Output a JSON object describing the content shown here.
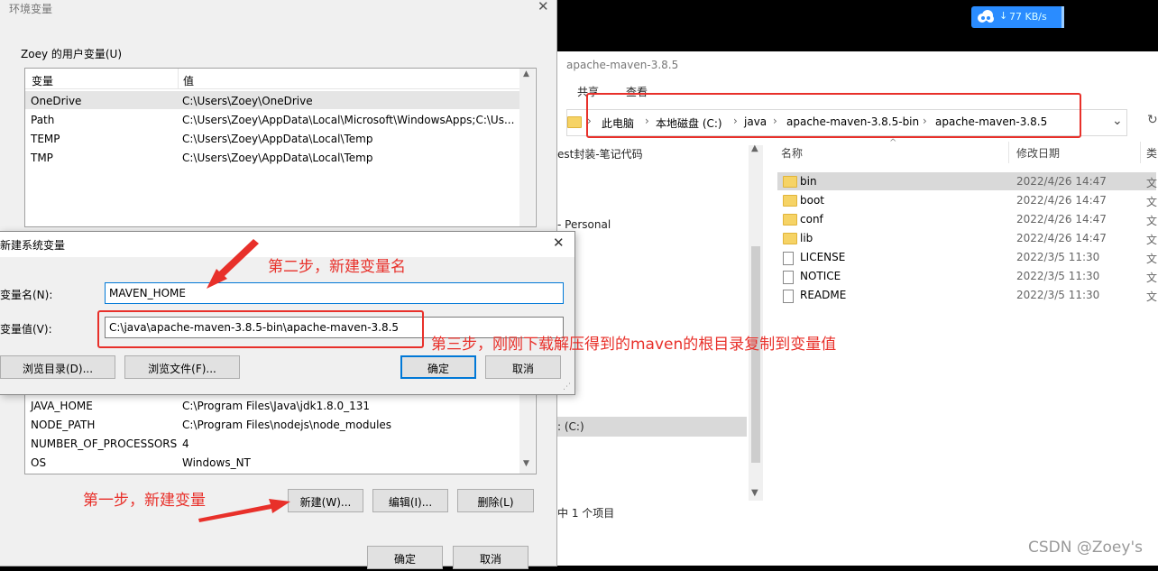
{
  "env_dialog": {
    "title": "环境变量",
    "user_group": "Zoey 的用户变量(U)",
    "headers": [
      "变量",
      "值"
    ],
    "user_vars": [
      {
        "name": "OneDrive",
        "value": "C:\\Users\\Zoey\\OneDrive"
      },
      {
        "name": "Path",
        "value": "C:\\Users\\Zoey\\AppData\\Local\\Microsoft\\WindowsApps;C:\\Us..."
      },
      {
        "name": "TEMP",
        "value": "C:\\Users\\Zoey\\AppData\\Local\\Temp"
      },
      {
        "name": "TMP",
        "value": "C:\\Users\\Zoey\\AppData\\Local\\Temp"
      }
    ],
    "sys_vars": [
      {
        "name": "JAVA_HOME",
        "value": "C:\\Program Files\\Java\\jdk1.8.0_131"
      },
      {
        "name": "NODE_PATH",
        "value": "C:\\Program Files\\nodejs\\node_modules"
      },
      {
        "name": "NUMBER_OF_PROCESSORS",
        "value": "4"
      },
      {
        "name": "OS",
        "value": "Windows_NT"
      }
    ],
    "btn_new": "新建(W)...",
    "btn_edit": "编辑(I)...",
    "btn_delete": "删除(L)",
    "btn_ok": "确定",
    "btn_cancel": "取消"
  },
  "new_var_dialog": {
    "title": "新建系统变量",
    "name_label": "变量名(N):",
    "name_value": "MAVEN_HOME",
    "value_label": "变量值(V):",
    "value_value": "C:\\java\\apache-maven-3.8.5-bin\\apache-maven-3.8.5",
    "btn_browse_dir": "浏览目录(D)...",
    "btn_browse_file": "浏览文件(F)...",
    "btn_ok": "确定",
    "btn_cancel": "取消"
  },
  "explorer": {
    "title": "apache-maven-3.8.5",
    "ribbon_tabs": [
      "共享",
      "查看"
    ],
    "breadcrumb": [
      "此电脑",
      "本地磁盘 (C:)",
      "java",
      "apache-maven-3.8.5-bin",
      "apache-maven-3.8.5"
    ],
    "nav_items": [
      "est封装-笔记代码",
      "- Personal",
      ": (C:)"
    ],
    "status": "中 1 个项目",
    "columns": [
      "名称",
      "修改日期",
      "类"
    ],
    "files": [
      {
        "name": "bin",
        "date": "2022/4/26 14:47",
        "type": "文",
        "kind": "folder"
      },
      {
        "name": "boot",
        "date": "2022/4/26 14:47",
        "type": "文",
        "kind": "folder"
      },
      {
        "name": "conf",
        "date": "2022/4/26 14:47",
        "type": "文",
        "kind": "folder"
      },
      {
        "name": "lib",
        "date": "2022/4/26 14:47",
        "type": "文",
        "kind": "folder"
      },
      {
        "name": "LICENSE",
        "date": "2022/3/5 11:30",
        "type": "文",
        "kind": "file"
      },
      {
        "name": "NOTICE",
        "date": "2022/3/5 11:30",
        "type": "文",
        "kind": "file"
      },
      {
        "name": "README",
        "date": "2022/3/5 11:30",
        "type": "文",
        "kind": "file"
      }
    ]
  },
  "annotations": {
    "step1": "第一步，新建变量",
    "step2": "第二步，新建变量名",
    "step3": "第三步，刚刚下载解压得到的maven的根目录复制到变量值"
  },
  "net_badge": {
    "speed": "77 KB/s",
    "icon": "cloud-icon"
  },
  "watermark": "CSDN @Zoey's",
  "colors": {
    "annotation_red": "#e8302a",
    "selection": "#cce8ff",
    "badge_blue": "#1e90ff"
  }
}
